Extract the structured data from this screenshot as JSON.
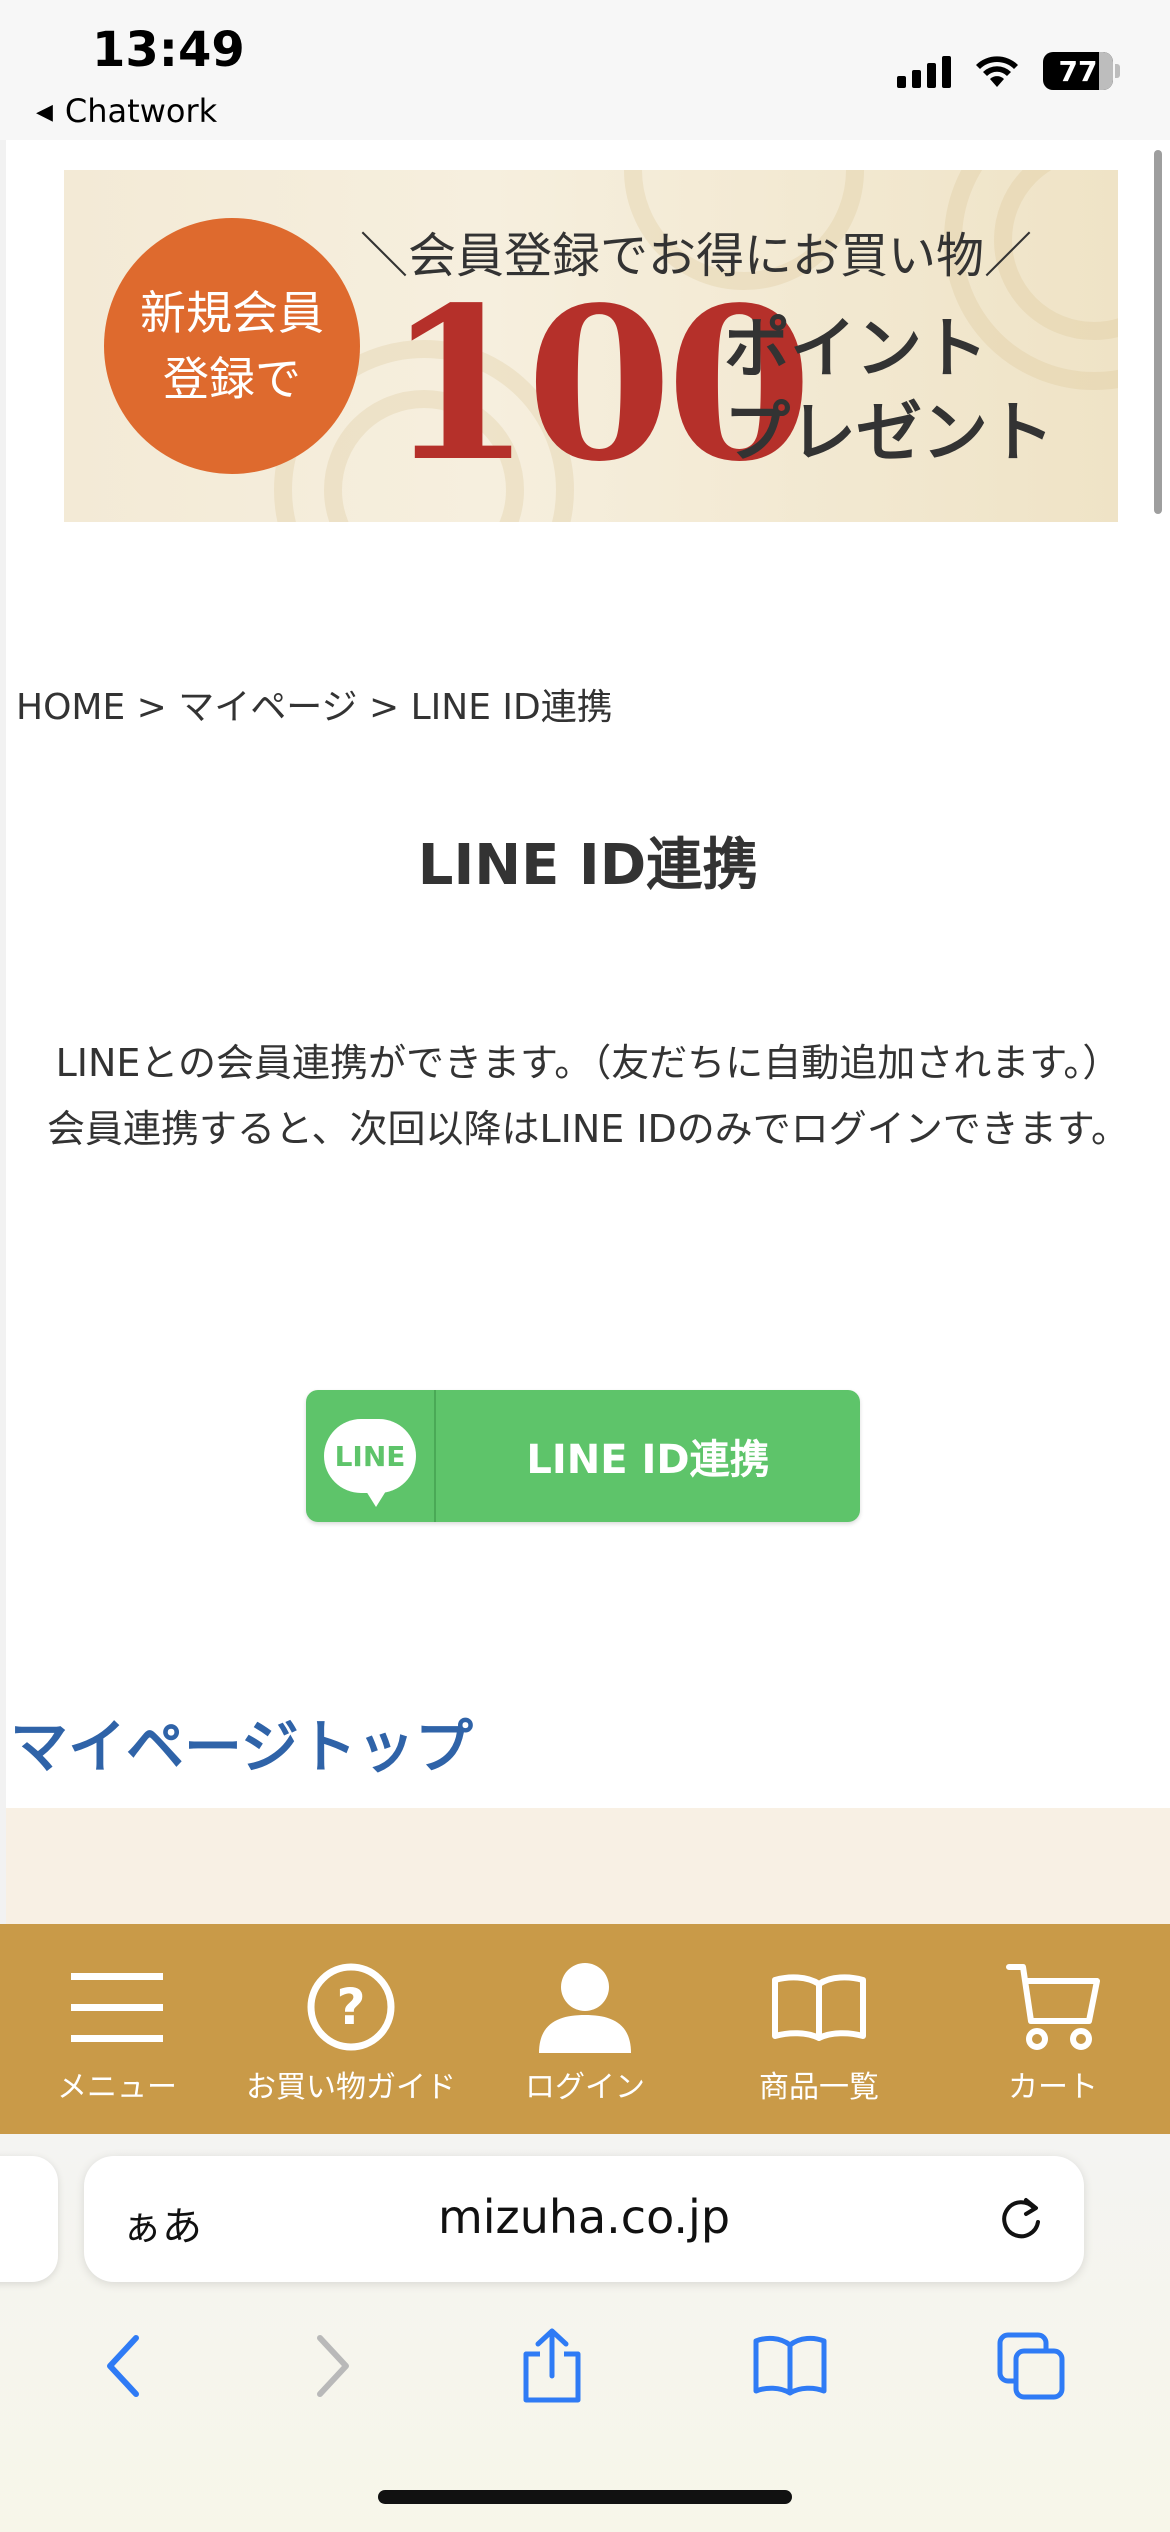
{
  "status_bar": {
    "time": "13:49",
    "back_app": "Chatwork",
    "battery": "77"
  },
  "banner": {
    "circle_line1": "新規会員",
    "circle_line2": "登録で",
    "tagline": "＼会員登録でお得にお買い物／",
    "points": "100",
    "present_line1": "ポイント",
    "present_line2": "プレゼント"
  },
  "breadcrumb": "HOME > マイページ > LINE ID連携",
  "page_title": "LINE ID連携",
  "description": {
    "line1": "LINEとの会員連携ができます。（友だちに自動追加されます。）",
    "line2": "会員連携すると、次回以降はLINE IDのみでログインできます。"
  },
  "line_button": {
    "logo_text": "LINE",
    "label": "LINE ID連携",
    "color": "#5ec46a"
  },
  "mypage_top": "マイページトップ",
  "site_nav": {
    "color": "#c99a48",
    "items": [
      {
        "label": "メニュー",
        "icon": "hamburger-icon"
      },
      {
        "label": "お買い物ガイド",
        "icon": "question-icon"
      },
      {
        "label": "ログイン",
        "icon": "user-icon"
      },
      {
        "label": "商品一覧",
        "icon": "book-icon"
      },
      {
        "label": "カート",
        "icon": "cart-icon"
      }
    ]
  },
  "browser": {
    "aa": "ぁあ",
    "url": "mizuha.co.jp"
  }
}
